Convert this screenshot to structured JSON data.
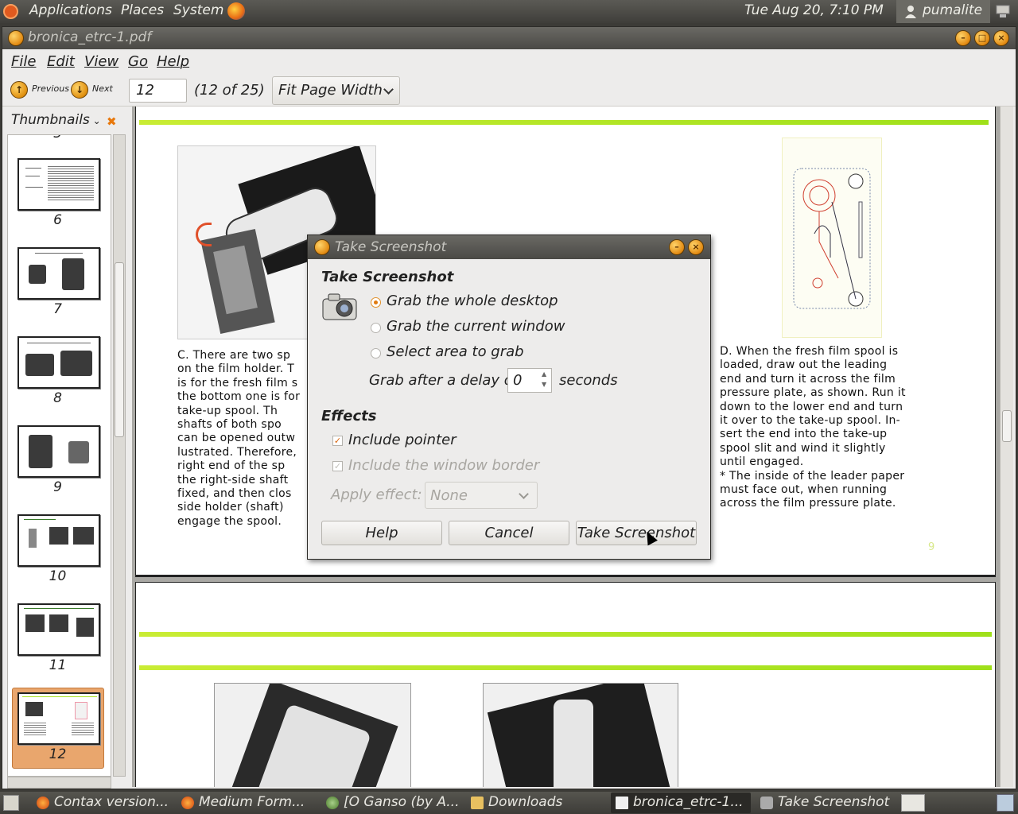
{
  "top_panel": {
    "applications": "Applications",
    "places": "Places",
    "system": "System",
    "clock": "Tue Aug 20,  7:10 PM",
    "user": "pumalite"
  },
  "window": {
    "title": "bronica_etrc-1.pdf",
    "menu": {
      "file": "File",
      "edit": "Edit",
      "view": "View",
      "go": "Go",
      "help": "Help"
    },
    "toolbar": {
      "previous": "Previous",
      "next": "Next",
      "page_value": "12",
      "page_count": "(12 of 25)",
      "zoom": "Fit Page Width"
    },
    "sidebar": {
      "title": "Thumbnails",
      "top_partial": "5",
      "thumbnails": [
        "6",
        "7",
        "8",
        "9",
        "10",
        "11",
        "12"
      ],
      "selected": "12"
    },
    "page_text": {
      "left_col": "C. There are two sp... on the film holder. T... is for the fresh film s... the bottom one is for... take-up spool. Th... shafts of both spo... can be opened outw... lustrated. Therefore,... right end of the sp... the right-side shaft... fixed, and then clos... side holder (shaft)... engage the spool.",
      "left_lines": [
        "C. There are two sp",
        "on the film holder. T",
        "is for the fresh film s",
        "the bottom one is for",
        "take-up spool. Th",
        "shafts of both spo",
        "can be opened outw",
        "lustrated. Therefore,",
        "right end of the sp",
        "the right-side shaft",
        "fixed, and then clos",
        "side holder (shaft)",
        "engage the spool."
      ],
      "right_lines": [
        "D. When the fresh film spool is",
        "loaded, draw out the leading",
        "end and turn it across the film",
        "pressure plate, as shown. Run it",
        "down to the lower end and turn",
        "it over to the take-up spool. In-",
        "sert the end into the take-up",
        "spool slit and wind it slightly",
        "until engaged.",
        "* The inside of the leader paper",
        "must face out, when running",
        "across the film pressure plate."
      ],
      "page_number": "9"
    }
  },
  "dialog": {
    "title": "Take Screenshot",
    "heading": "Take Screenshot",
    "opt_desktop": "Grab the whole desktop",
    "opt_window": "Grab the current window",
    "opt_area": "Select area to grab",
    "delay_label": "Grab after a delay of",
    "delay_value": "0",
    "delay_unit": "seconds",
    "effects_heading": "Effects",
    "include_pointer": "Include pointer",
    "include_border": "Include the window border",
    "apply_effect_label": "Apply effect:",
    "apply_effect_value": "None",
    "help_button": "Help",
    "cancel_button": "Cancel",
    "take_button": "Take Screenshot"
  },
  "taskbar": {
    "tasks": [
      "Contax version...",
      "Medium Form...",
      "[O Ganso (by A...",
      "Downloads",
      "bronica_etrc-1...",
      "Take Screenshot"
    ]
  },
  "colors": {
    "accent_orange": "#e07b10",
    "panel_dark": "#3f3e3a",
    "page_green_rule": "#a9e21e",
    "selected_thumb": "#e9a66d"
  }
}
